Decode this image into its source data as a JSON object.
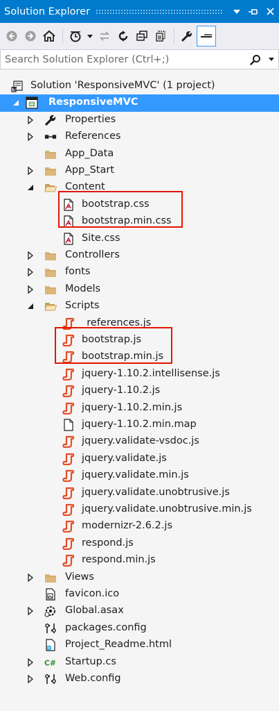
{
  "window": {
    "title": "Solution Explorer",
    "dropdown_icon": "triangle-down-icon",
    "pin_icon": "pin-icon",
    "close_icon": "close-icon"
  },
  "toolbar": {
    "items": [
      "back-icon",
      "forward-icon",
      "home-icon",
      "pending-changes-filter-icon",
      "sync-with-active-document-icon",
      "refresh-icon",
      "collapse-all-icon",
      "show-all-files-icon",
      "properties-icon",
      "preview-selected-items-icon"
    ]
  },
  "search": {
    "placeholder": "Search Solution Explorer (Ctrl+;)",
    "value": ""
  },
  "tree": {
    "items": [
      {
        "label": "Solution 'ResponsiveMVC' (1 project)",
        "icon": "solution-icon",
        "level": 0,
        "expander": "none"
      },
      {
        "label": "ResponsiveMVC",
        "icon": "web-project-icon",
        "level": 1,
        "expander": "expanded",
        "selected": true
      },
      {
        "label": "Properties",
        "icon": "wrench-icon",
        "level": 2,
        "expander": "collapsed"
      },
      {
        "label": "References",
        "icon": "references-icon",
        "level": 2,
        "expander": "collapsed"
      },
      {
        "label": "App_Data",
        "icon": "folder-icon",
        "level": 2,
        "expander": "none"
      },
      {
        "label": "App_Start",
        "icon": "folder-icon",
        "level": 2,
        "expander": "collapsed"
      },
      {
        "label": "Content",
        "icon": "folder-open-icon",
        "level": 2,
        "expander": "expanded"
      },
      {
        "label": "bootstrap.css",
        "icon": "css-file-icon",
        "level": 3,
        "expander": "none"
      },
      {
        "label": "bootstrap.min.css",
        "icon": "css-file-icon",
        "level": 3,
        "expander": "none"
      },
      {
        "label": "Site.css",
        "icon": "css-file-icon",
        "level": 3,
        "expander": "none"
      },
      {
        "label": "Controllers",
        "icon": "folder-icon",
        "level": 2,
        "expander": "collapsed"
      },
      {
        "label": "fonts",
        "icon": "folder-icon",
        "level": 2,
        "expander": "collapsed"
      },
      {
        "label": "Models",
        "icon": "folder-icon",
        "level": 2,
        "expander": "collapsed"
      },
      {
        "label": "Scripts",
        "icon": "folder-open-icon",
        "level": 2,
        "expander": "expanded"
      },
      {
        "label": "_references.js",
        "icon": "js-file-icon",
        "level": 3,
        "expander": "none"
      },
      {
        "label": "bootstrap.js",
        "icon": "js-file-icon",
        "level": 3,
        "expander": "none"
      },
      {
        "label": "bootstrap.min.js",
        "icon": "js-file-icon",
        "level": 3,
        "expander": "none"
      },
      {
        "label": "jquery-1.10.2.intellisense.js",
        "icon": "js-file-icon",
        "level": 3,
        "expander": "none"
      },
      {
        "label": "jquery-1.10.2.js",
        "icon": "js-file-icon",
        "level": 3,
        "expander": "none"
      },
      {
        "label": "jquery-1.10.2.min.js",
        "icon": "js-file-icon",
        "level": 3,
        "expander": "none"
      },
      {
        "label": "jquery-1.10.2.min.map",
        "icon": "blank-file-icon",
        "level": 3,
        "expander": "none"
      },
      {
        "label": "jquery.validate-vsdoc.js",
        "icon": "js-file-icon",
        "level": 3,
        "expander": "none"
      },
      {
        "label": "jquery.validate.js",
        "icon": "js-file-icon",
        "level": 3,
        "expander": "none"
      },
      {
        "label": "jquery.validate.min.js",
        "icon": "js-file-icon",
        "level": 3,
        "expander": "none"
      },
      {
        "label": "jquery.validate.unobtrusive.js",
        "icon": "js-file-icon",
        "level": 3,
        "expander": "none"
      },
      {
        "label": "jquery.validate.unobtrusive.min.js",
        "icon": "js-file-icon",
        "level": 3,
        "expander": "none"
      },
      {
        "label": "modernizr-2.6.2.js",
        "icon": "js-file-icon",
        "level": 3,
        "expander": "none"
      },
      {
        "label": "respond.js",
        "icon": "js-file-icon",
        "level": 3,
        "expander": "none"
      },
      {
        "label": "respond.min.js",
        "icon": "js-file-icon",
        "level": 3,
        "expander": "none"
      },
      {
        "label": "Views",
        "icon": "folder-icon",
        "level": 2,
        "expander": "collapsed"
      },
      {
        "label": "favicon.ico",
        "icon": "icon-file-icon",
        "level": 2,
        "expander": "none"
      },
      {
        "label": "Global.asax",
        "icon": "global-asax-icon",
        "level": 2,
        "expander": "collapsed"
      },
      {
        "label": "packages.config",
        "icon": "config-file-icon",
        "level": 2,
        "expander": "none"
      },
      {
        "label": "Project_Readme.html",
        "icon": "html-file-icon",
        "level": 2,
        "expander": "none"
      },
      {
        "label": "Startup.cs",
        "icon": "csharp-file-icon",
        "level": 2,
        "expander": "collapsed"
      },
      {
        "label": "Web.config",
        "icon": "config-file-icon",
        "level": 2,
        "expander": "collapsed"
      }
    ]
  },
  "colors": {
    "title_bar": "#007acc",
    "selection": "#3399ff",
    "highlight_box": "#e51400",
    "folder": "#dcb67a",
    "js": "#e44d26"
  }
}
